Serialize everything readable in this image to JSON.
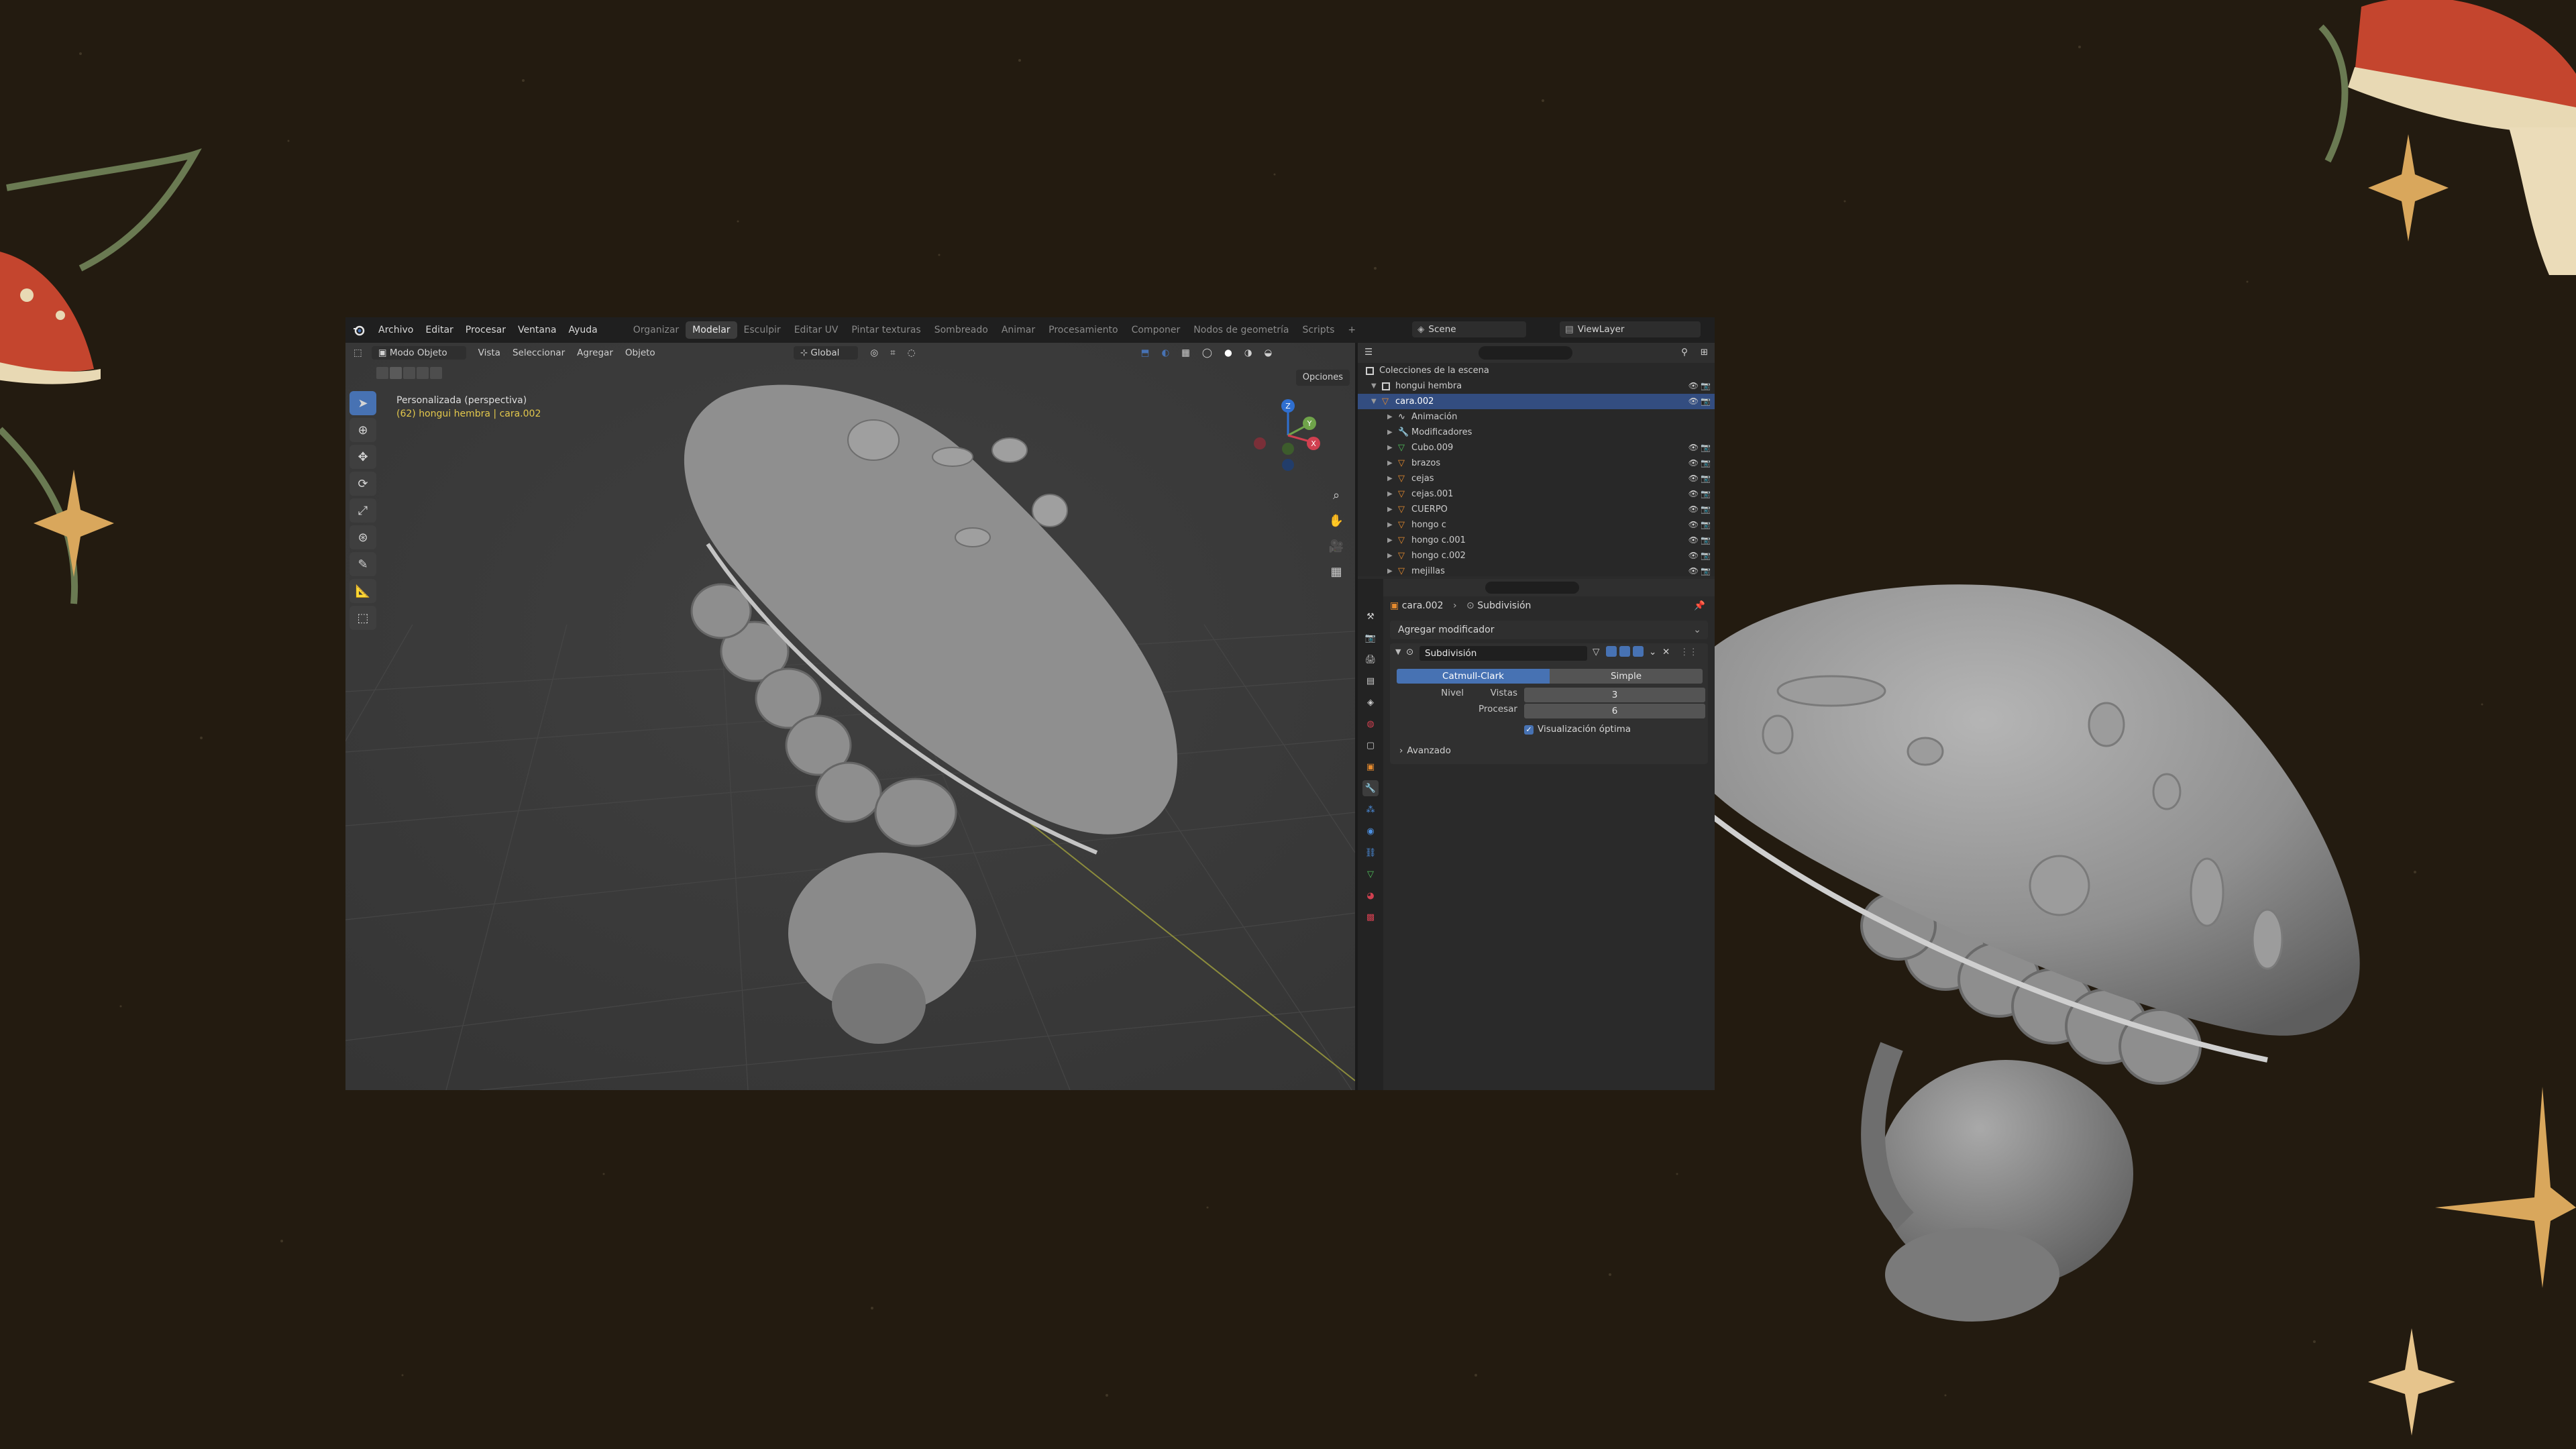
{
  "window": {
    "menu": [
      "Archivo",
      "Editar",
      "Procesar",
      "Ventana",
      "Ayuda"
    ],
    "workspaces": [
      "Organizar",
      "Modelar",
      "Esculpir",
      "Editar UV",
      "Pintar texturas",
      "Sombreado",
      "Animar",
      "Procesamiento",
      "Componer",
      "Nodos de geometría",
      "Scripts"
    ],
    "active_workspace": "Modelar",
    "add_tab": "+",
    "scene": "Scene",
    "view_layer": "ViewLayer"
  },
  "viewport": {
    "header": {
      "mode": "Modo Objeto",
      "menus": [
        "Vista",
        "Seleccionar",
        "Agregar",
        "Objeto"
      ],
      "transform_orientation": "Global"
    },
    "view_name": "Personalizada (perspectiva)",
    "object_info": "(62) hongui hembra | cara.002",
    "options_label": "Opciones",
    "gizmo_axes": {
      "z": "Z",
      "y": "Y",
      "x": "X"
    }
  },
  "outliner": {
    "root": "Colecciones de la escena",
    "collection": "hongui hembra",
    "rows": [
      {
        "label": "cara.002",
        "depth": 1,
        "selected": true,
        "type": "mesh"
      },
      {
        "label": "Animación",
        "depth": 2,
        "selected": false,
        "type": "anim"
      },
      {
        "label": "Modificadores",
        "depth": 2,
        "selected": false,
        "type": "wrench"
      },
      {
        "label": "Cubo.009",
        "depth": 2,
        "selected": false,
        "type": "mesh-green"
      },
      {
        "label": "brazos",
        "depth": 2,
        "selected": false,
        "type": "mesh"
      },
      {
        "label": "cejas",
        "depth": 2,
        "selected": false,
        "type": "mesh"
      },
      {
        "label": "cejas.001",
        "depth": 2,
        "selected": false,
        "type": "mesh"
      },
      {
        "label": "CUERPO",
        "depth": 2,
        "selected": false,
        "type": "mesh"
      },
      {
        "label": "hongo c",
        "depth": 2,
        "selected": false,
        "type": "mesh"
      },
      {
        "label": "hongo c.001",
        "depth": 2,
        "selected": false,
        "type": "mesh"
      },
      {
        "label": "hongo c.002",
        "depth": 2,
        "selected": false,
        "type": "mesh"
      },
      {
        "label": "mejillas",
        "depth": 2,
        "selected": false,
        "type": "mesh"
      }
    ]
  },
  "properties": {
    "breadcrumb_object": "cara.002",
    "breadcrumb_modifier": "Subdivisión",
    "add_modifier": "Agregar modificador",
    "modifier": {
      "name": "Subdivisión",
      "type_catmull": "Catmull-Clark",
      "type_simple": "Simple",
      "level_label": "Nivel",
      "viewport_label": "Vistas",
      "viewport_value": "3",
      "render_label": "Procesar",
      "render_value": "6",
      "optimal_label": "Visualización óptima",
      "advanced_label": "Avanzado"
    }
  },
  "colors": {
    "background": "#231b10",
    "accent": "#4772b3",
    "selected_row": "#334d80",
    "mushroom_red": "#c0402a"
  }
}
